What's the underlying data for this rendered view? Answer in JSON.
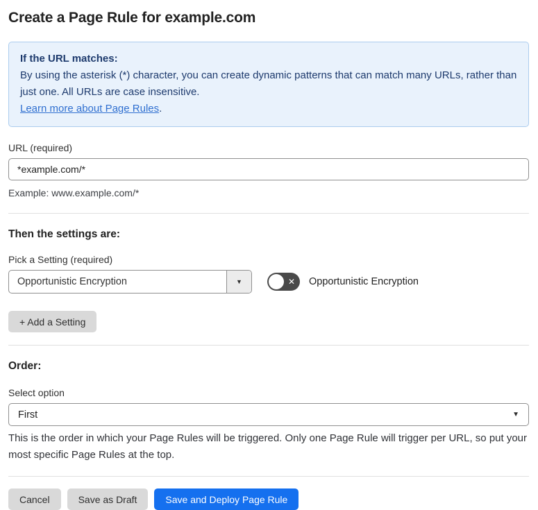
{
  "page": {
    "title": "Create a Page Rule for example.com"
  },
  "info_box": {
    "heading": "If the URL matches:",
    "body": "By using the asterisk (*) character, you can create dynamic patterns that can match many URLs, rather than just one. All URLs are case insensitive.",
    "link_label": "Learn more about Page Rules",
    "link_suffix": "."
  },
  "url_section": {
    "label": "URL (required)",
    "input_value": "*example.com/*",
    "helper": "Example: www.example.com/*"
  },
  "settings_section": {
    "heading": "Then the settings are:",
    "picker_label": "Pick a Setting (required)",
    "selected_setting": "Opportunistic Encryption",
    "toggle": {
      "state": "off",
      "label": "Opportunistic Encryption"
    },
    "add_setting_label": "+ Add a Setting"
  },
  "order_section": {
    "heading": "Order:",
    "select_label": "Select option",
    "selected_option": "First",
    "helper": "This is the order in which your Page Rules will be triggered. Only one Page Rule will trigger per URL, so put your most specific Page Rules at the top."
  },
  "footer": {
    "cancel_label": "Cancel",
    "save_draft_label": "Save as Draft",
    "save_deploy_label": "Save and Deploy Page Rule"
  },
  "icons": {
    "combo_caret": "▼",
    "select_caret": "▼",
    "toggle_off_x": "✕"
  },
  "colors": {
    "primary_blue": "#1570EF",
    "info_bg": "#e9f2fc",
    "info_border": "#abccee",
    "info_text": "#1d3a6d",
    "link_blue": "#2f6fd0",
    "toggle_off": "#4a4a4a",
    "button_gray": "#d9d9d9"
  }
}
